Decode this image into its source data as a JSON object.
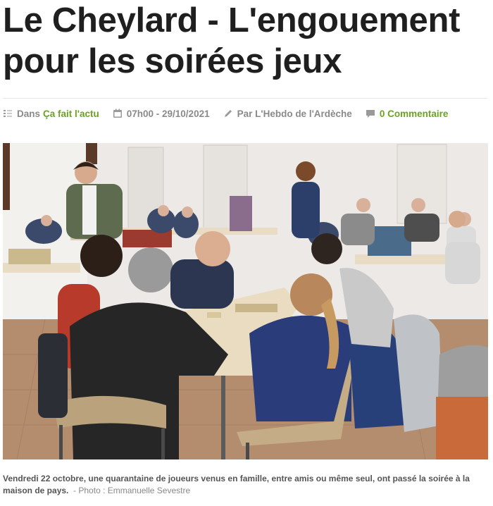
{
  "article": {
    "title": "Le Cheylard - L'engouement pour les soirées jeux"
  },
  "meta": {
    "category_prefix": "Dans",
    "category": "Ça fait l'actu",
    "datetime": "07h00 - 29/10/2021",
    "author": "Par L'Hebdo de l'Ardèche",
    "comments": "0 Commentaire"
  },
  "icons": {
    "category": "folder-tree-icon",
    "date": "calendar-icon",
    "author": "pencil-icon",
    "comments": "comment-icon"
  },
  "photo": {
    "alt": ""
  },
  "caption": {
    "text": "Vendredi 22 octobre, une quarantaine de joueurs venus en famille, entre amis ou même seul, ont passé la soirée à la maison de pays.",
    "credit": "- Photo : Emmanuelle Sevestre"
  },
  "colors": {
    "title": "#1f1f1f",
    "meta": "#8a8a8a",
    "accent": "#6aa223",
    "caption": "#555555"
  }
}
